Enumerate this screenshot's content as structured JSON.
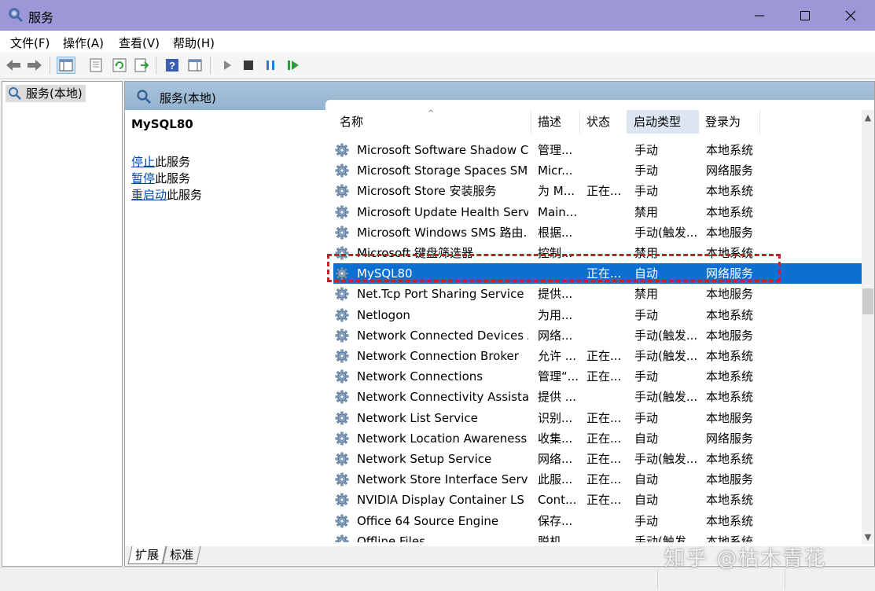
{
  "window": {
    "title": "服务",
    "controls": [
      "minimize",
      "maximize",
      "close"
    ]
  },
  "menu": {
    "items": [
      "文件(F)",
      "操作(A)",
      "查看(V)",
      "帮助(H)"
    ]
  },
  "toolbar": {
    "icons": [
      "back-icon",
      "forward-icon",
      "show-hide-tree-icon",
      "properties-icon",
      "refresh-icon",
      "export-list-icon",
      "help-icon",
      "show-hide-action-pane-icon",
      "start-icon",
      "stop-icon",
      "pause-icon",
      "restart-icon"
    ]
  },
  "tree": {
    "root_label": "服务(本地)"
  },
  "main": {
    "header_title": "服务(本地)",
    "detail": {
      "service_name": "MySQL80",
      "actions": [
        {
          "link": "停止",
          "suffix": "此服务"
        },
        {
          "link": "暂停",
          "suffix": "此服务"
        },
        {
          "link": "重启动",
          "suffix": "此服务"
        }
      ]
    },
    "columns": [
      "名称",
      "描述",
      "状态",
      "启动类型",
      "登录为"
    ],
    "sorted_column": "启动类型",
    "rows": [
      {
        "name": "Microsoft Software Shadow Co...",
        "desc": "管理...",
        "status": "",
        "startup": "手动",
        "logon": "本地系统"
      },
      {
        "name": "Microsoft Storage Spaces SMP",
        "desc": "Micr...",
        "status": "",
        "startup": "手动",
        "logon": "网络服务"
      },
      {
        "name": "Microsoft Store 安装服务",
        "desc": "为 M...",
        "status": "正在...",
        "startup": "手动",
        "logon": "本地系统"
      },
      {
        "name": "Microsoft Update Health Service",
        "desc": "Main...",
        "status": "",
        "startup": "禁用",
        "logon": "本地系统"
      },
      {
        "name": "Microsoft Windows SMS 路由...",
        "desc": "根据...",
        "status": "",
        "startup": "手动(触发...",
        "logon": "本地服务"
      },
      {
        "name": "Microsoft 键盘筛选器",
        "desc": "控制...",
        "status": "",
        "startup": "禁用",
        "logon": "本地系统"
      },
      {
        "name": "MySQL80",
        "desc": "",
        "status": "正在...",
        "startup": "自动",
        "logon": "网络服务",
        "selected": true
      },
      {
        "name": "Net.Tcp Port Sharing Service",
        "desc": "提供...",
        "status": "",
        "startup": "禁用",
        "logon": "本地服务"
      },
      {
        "name": "Netlogon",
        "desc": "为用...",
        "status": "",
        "startup": "手动",
        "logon": "本地系统"
      },
      {
        "name": "Network Connected Devices A...",
        "desc": "网络...",
        "status": "",
        "startup": "手动(触发...",
        "logon": "本地服务"
      },
      {
        "name": "Network Connection Broker",
        "desc": "允许 ...",
        "status": "正在...",
        "startup": "手动(触发...",
        "logon": "本地系统"
      },
      {
        "name": "Network Connections",
        "desc": "管理“...",
        "status": "正在...",
        "startup": "手动",
        "logon": "本地系统"
      },
      {
        "name": "Network Connectivity Assistant",
        "desc": "提供 ...",
        "status": "",
        "startup": "手动(触发...",
        "logon": "本地系统"
      },
      {
        "name": "Network List Service",
        "desc": "识别...",
        "status": "正在...",
        "startup": "手动",
        "logon": "本地服务"
      },
      {
        "name": "Network Location Awareness",
        "desc": "收集...",
        "status": "正在...",
        "startup": "自动",
        "logon": "网络服务"
      },
      {
        "name": "Network Setup Service",
        "desc": "网络...",
        "status": "正在...",
        "startup": "手动(触发...",
        "logon": "本地系统"
      },
      {
        "name": "Network Store Interface Service",
        "desc": "此服...",
        "status": "正在...",
        "startup": "自动",
        "logon": "本地服务"
      },
      {
        "name": "NVIDIA Display Container LS",
        "desc": "Cont...",
        "status": "正在...",
        "startup": "自动",
        "logon": "本地系统"
      },
      {
        "name": "Office 64 Source Engine",
        "desc": "保存...",
        "status": "",
        "startup": "手动",
        "logon": "本地系统"
      },
      {
        "name": "Offline Files",
        "desc": "脱机...",
        "status": "",
        "startup": "手动(触发...",
        "logon": "本地系统"
      }
    ],
    "tabs": [
      "扩展",
      "标准"
    ],
    "active_tab": "扩展"
  },
  "annotation": {
    "highlight_color": "#c8202a"
  },
  "watermark": "知乎 @枯木青花",
  "colors": {
    "titlebar": "#9d97d8",
    "selection": "#0c6fd1",
    "link": "#0047ab"
  }
}
